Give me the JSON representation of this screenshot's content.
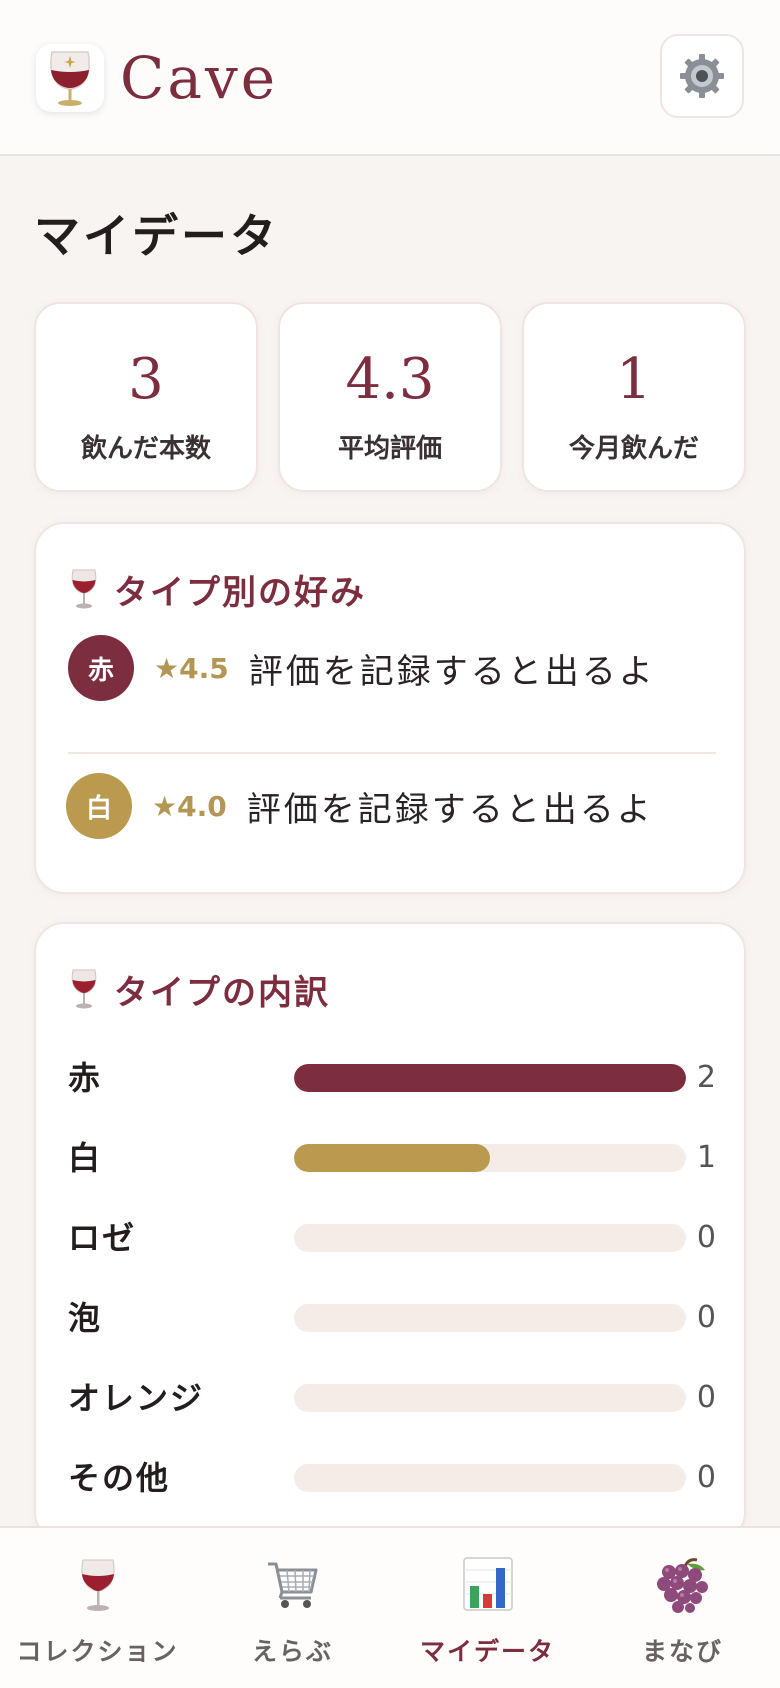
{
  "header": {
    "app_title": "Cave",
    "logo_icon": "wine-glass-icon",
    "settings_icon": "gear-icon"
  },
  "page_title": "マイデータ",
  "stats": [
    {
      "value": "3",
      "label": "飲んだ本数"
    },
    {
      "value": "4.3",
      "label": "平均評価"
    },
    {
      "value": "1",
      "label": "今月飲んだ"
    }
  ],
  "preferences": {
    "heading_icon": "wine-glass-icon",
    "title": "タイプ別の好み",
    "rows": [
      {
        "badge": "赤",
        "rating": "★4.5",
        "note": "評価を記録すると出るよ",
        "color": "#7c2d3e"
      },
      {
        "badge": "白",
        "rating": "★4.0",
        "note": "評価を記録すると出るよ",
        "color": "#b99a4f"
      }
    ]
  },
  "breakdown": {
    "heading_icon": "wine-glass-icon",
    "title": "タイプの内訳",
    "max": 2,
    "rows": [
      {
        "label": "赤",
        "count": 2,
        "color": "#7c2d3e"
      },
      {
        "label": "白",
        "count": 1,
        "color": "#b99a4f"
      },
      {
        "label": "ロゼ",
        "count": 0,
        "color": "#d98c9a"
      },
      {
        "label": "泡",
        "count": 0,
        "color": "#c9b36b"
      },
      {
        "label": "オレンジ",
        "count": 0,
        "color": "#d58a3f"
      },
      {
        "label": "その他",
        "count": 0,
        "color": "#999999"
      }
    ]
  },
  "tabs": [
    {
      "label": "コレクション",
      "icon": "wine-glass-icon",
      "active": false
    },
    {
      "label": "えらぶ",
      "icon": "shopping-cart-icon",
      "active": false
    },
    {
      "label": "マイデータ",
      "icon": "bar-chart-icon",
      "active": true
    },
    {
      "label": "まなび",
      "icon": "grapes-icon",
      "active": false
    }
  ]
}
